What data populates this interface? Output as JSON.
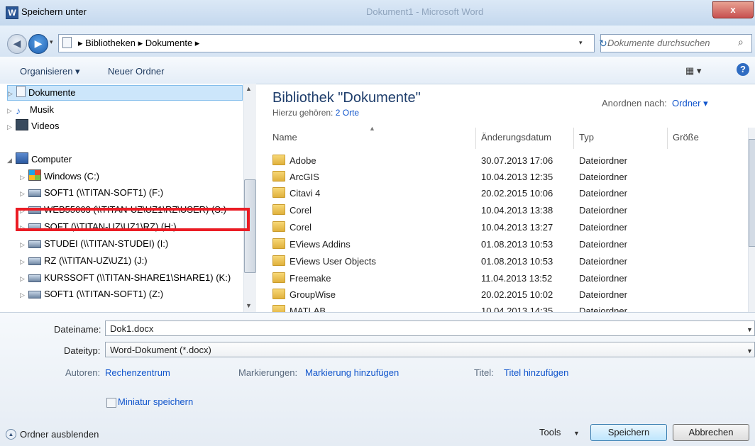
{
  "window": {
    "app_icon": "W",
    "title": "Speichern unter",
    "background_title": "Dokument1 - Microsoft Word",
    "close": "x"
  },
  "nav": {
    "back": "◀",
    "forward": "▶",
    "breadcrumb": "▸ Bibliotheken ▸ Dokumente ▸",
    "refresh": "↻",
    "search_placeholder": "Dokumente durchsuchen",
    "search_icon": "⌕"
  },
  "toolbar": {
    "organize": "Organisieren ▾",
    "new_folder": "Neuer Ordner",
    "view": "▦ ▾",
    "help": "?"
  },
  "tree": {
    "documents": "Dokumente",
    "music": "Musik",
    "videos": "Videos",
    "computer": "Computer",
    "drives": [
      "Windows (C:)",
      "SOFT1 (\\\\TITAN-SOFT1) (F:)",
      "WEB55063 (\\\\TITAN-UZ\\UZ1\\RZ\\USER) (S:)",
      "SOFT (\\\\TITAN-UZ\\UZ1\\RZ) (H:)",
      "STUDEI (\\\\TITAN-STUDEI) (I:)",
      "RZ (\\\\TITAN-UZ\\UZ1) (J:)",
      "KURSSOFT (\\\\TITAN-SHARE1\\SHARE1) (K:)",
      "SOFT1 (\\\\TITAN-SOFT1) (Z:)"
    ]
  },
  "library": {
    "title": "Bibliothek \"Dokumente\"",
    "includes_label": "Hierzu gehören:",
    "includes_link": "2 Orte",
    "arrange_label": "Anordnen nach:",
    "arrange_value": "Ordner ▾"
  },
  "columns": [
    "Name",
    "Änderungsdatum",
    "Typ",
    "Größe"
  ],
  "files": [
    {
      "name": "Adobe",
      "date": "30.07.2013 17:06",
      "type": "Dateiordner"
    },
    {
      "name": "ArcGIS",
      "date": "10.04.2013 12:35",
      "type": "Dateiordner"
    },
    {
      "name": "Citavi 4",
      "date": "20.02.2015 10:06",
      "type": "Dateiordner"
    },
    {
      "name": "Corel",
      "date": "10.04.2013 13:38",
      "type": "Dateiordner"
    },
    {
      "name": "Corel",
      "date": "10.04.2013 13:27",
      "type": "Dateiordner"
    },
    {
      "name": "EViews Addins",
      "date": "01.08.2013 10:53",
      "type": "Dateiordner"
    },
    {
      "name": "EViews User Objects",
      "date": "01.08.2013 10:53",
      "type": "Dateiordner"
    },
    {
      "name": "Freemake",
      "date": "11.04.2013 13:52",
      "type": "Dateiordner"
    },
    {
      "name": "GroupWise",
      "date": "20.02.2015 10:02",
      "type": "Dateiordner"
    },
    {
      "name": "MATLAB",
      "date": "10.04.2013 14:35",
      "type": "Dateiordner"
    }
  ],
  "form": {
    "filename_label": "Dateiname:",
    "filename_value": "Dok1.docx",
    "filetype_label": "Dateityp:",
    "filetype_value": "Word-Dokument (*.docx)",
    "authors_label": "Autoren:",
    "authors_value": "Rechenzentrum",
    "tags_label": "Markierungen:",
    "tags_value": "Markierung hinzufügen",
    "title_label": "Titel:",
    "title_value": "Titel hinzufügen",
    "thumbnail_label": "Miniatur speichern",
    "hide_folders": "Ordner ausblenden",
    "tools": "Tools",
    "save": "Speichern",
    "cancel": "Abbrechen"
  }
}
